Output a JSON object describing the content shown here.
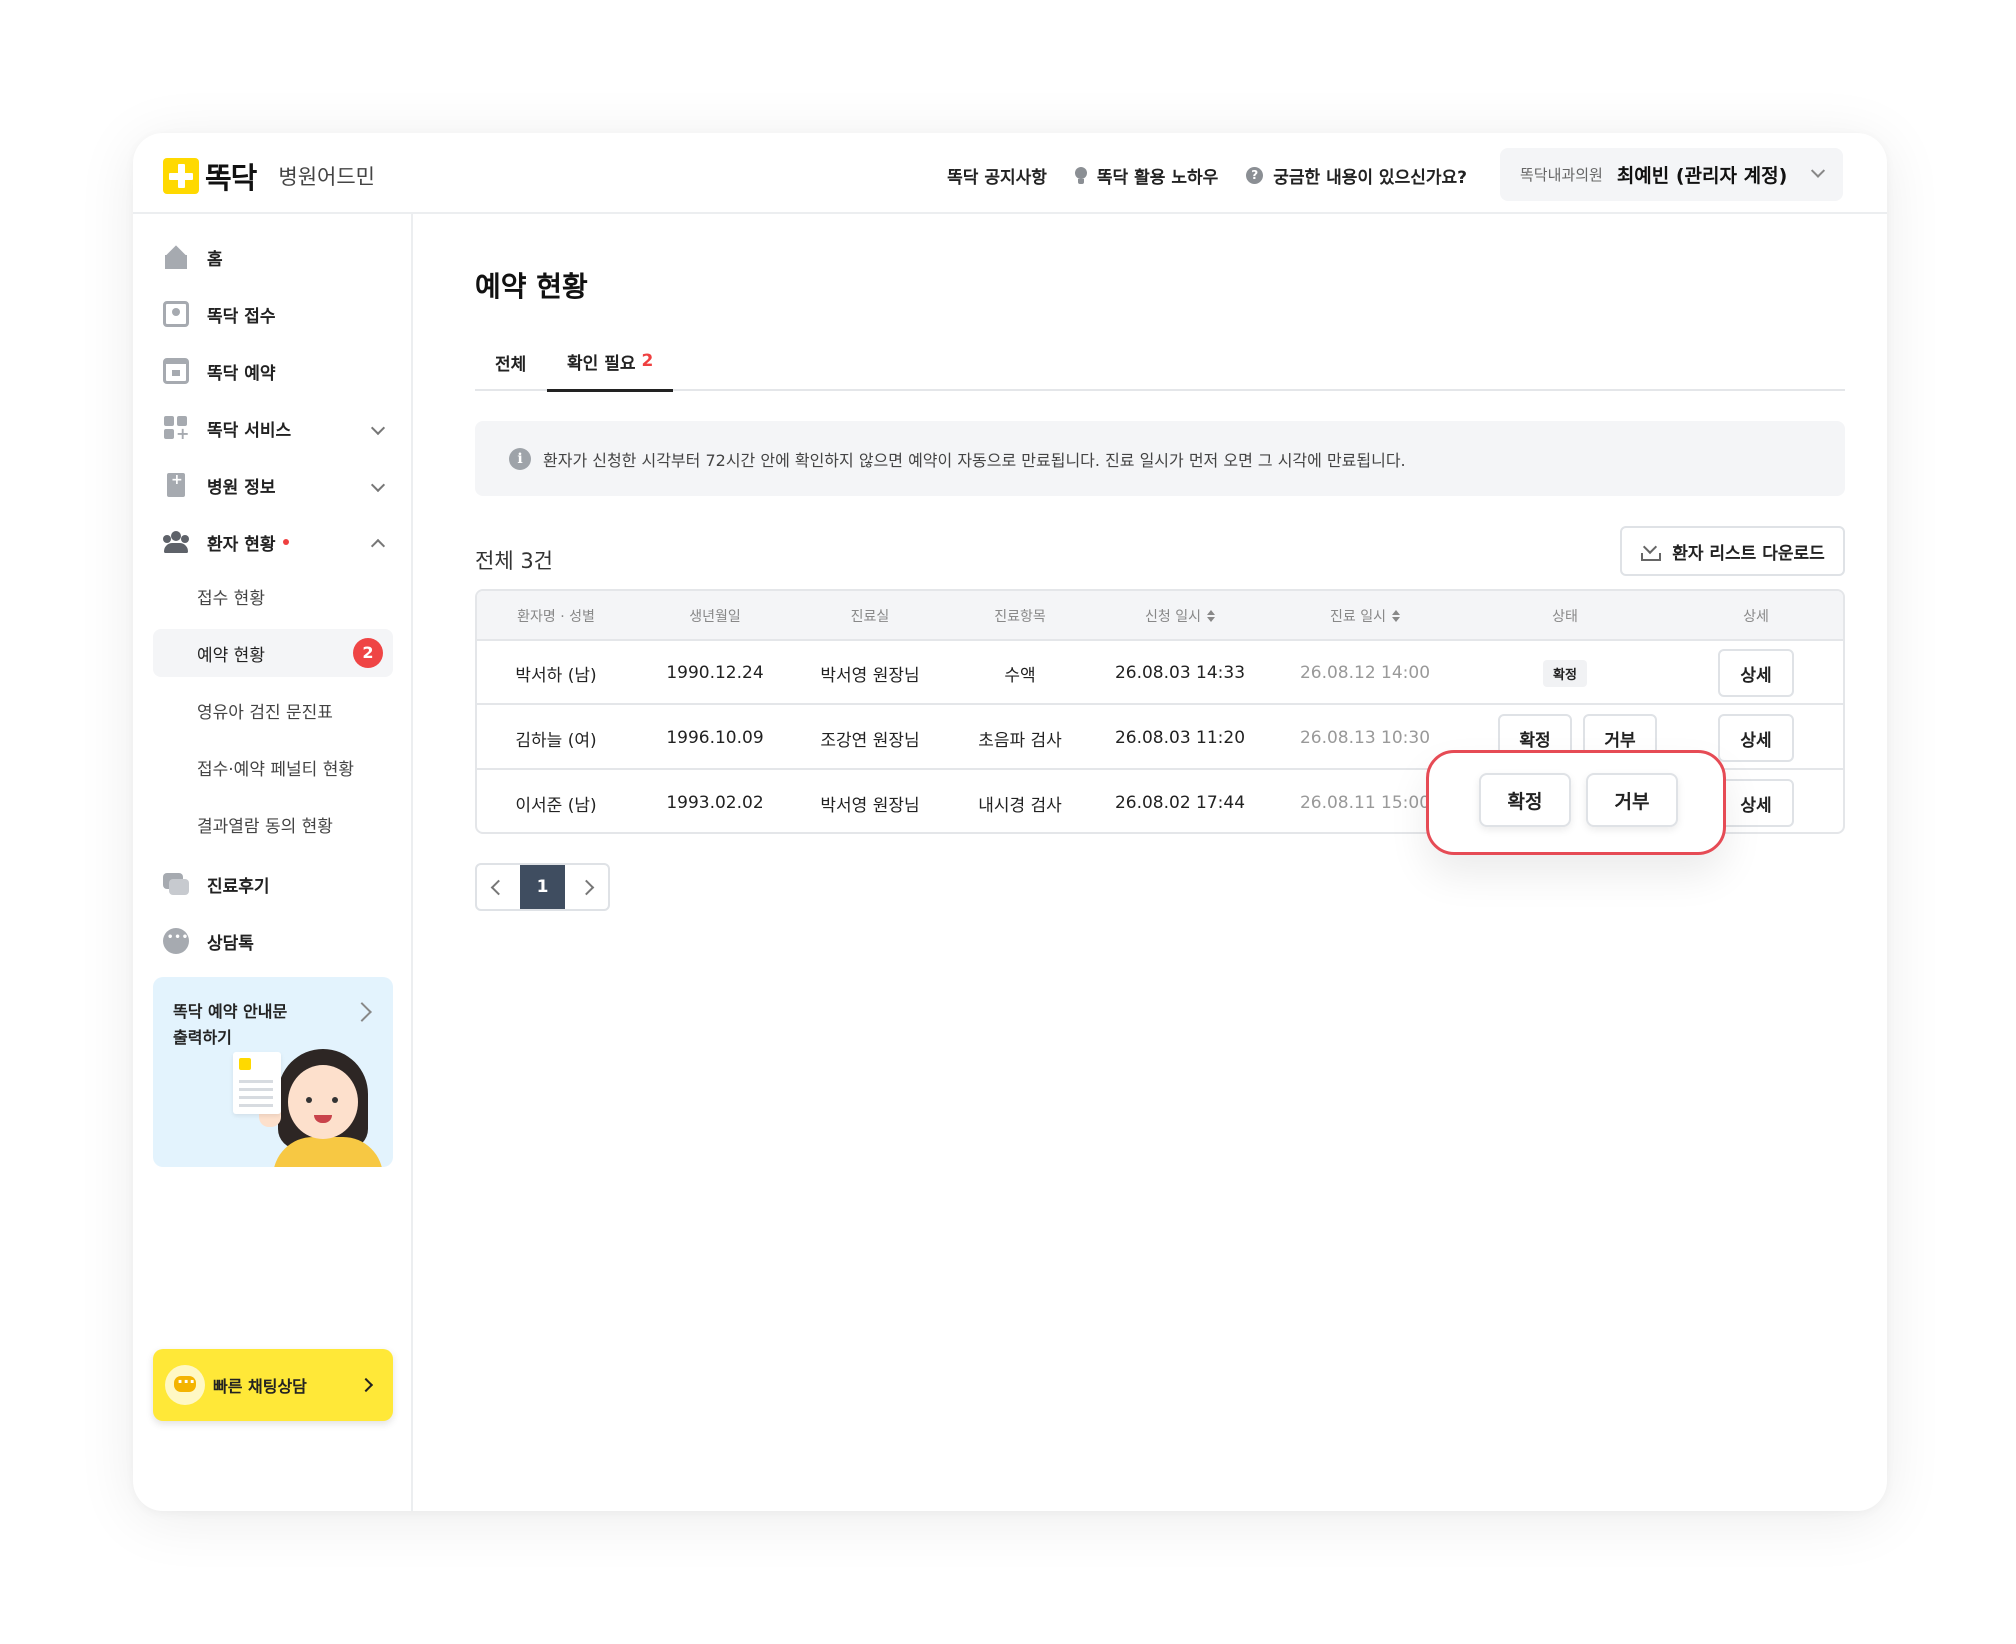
{
  "header": {
    "brand": "똑닥",
    "app_name": "병원어드민",
    "links": [
      "똑닥 공지사항",
      "똑닥 활용 노하우",
      "궁금한 내용이 있으신가요?"
    ],
    "account_hospital": "똑닥내과의원",
    "account_user": "최예빈 (관리자 계정)"
  },
  "sidebar": {
    "items": [
      {
        "label": "홈",
        "icon": "home-icon"
      },
      {
        "label": "똑닥 접수",
        "icon": "reception-icon"
      },
      {
        "label": "똑닥 예약",
        "icon": "calendar-icon"
      },
      {
        "label": "똑닥 서비스",
        "icon": "grid-plus-icon"
      },
      {
        "label": "병원 정보",
        "icon": "hospital-icon"
      },
      {
        "label": "환자 현황",
        "icon": "people-icon"
      },
      {
        "label": "진료후기",
        "icon": "review-icon"
      },
      {
        "label": "상담톡",
        "icon": "chat-icon"
      }
    ],
    "sub_items": [
      {
        "label": "접수 현황"
      },
      {
        "label": "예약 현황",
        "count": "2"
      },
      {
        "label": "영유아 검진 문진표"
      },
      {
        "label": "접수·예약 페널티 현황"
      },
      {
        "label": "결과열람 동의 현황"
      }
    ],
    "promo_text_line1": "똑닥 예약 안내문",
    "promo_text_line2": "출력하기",
    "quick_chat": "빠른 채팅상담"
  },
  "main": {
    "title": "예약 현황",
    "tabs": [
      {
        "label": "전체"
      },
      {
        "label": "확인 필요",
        "count": "2"
      }
    ],
    "notice": "환자가 신청한 시각부터 72시간 안에 확인하지 않으면 예약이 자동으로 만료됩니다. 진료 일시가 먼저 오면 그 시각에 만료됩니다.",
    "total": "전체 3건",
    "download_label": "환자 리스트 다운로드",
    "columns": [
      "환자명 · 성별",
      "생년월일",
      "진료실",
      "진료항목",
      "신청 일시",
      "진료 일시",
      "상태",
      "상세"
    ],
    "rows": [
      {
        "name": "박서하 (남)",
        "birth": "1990.12.24",
        "room": "박서영 원장님",
        "item": "수액",
        "applied": "26.08.03 14:33",
        "visit": "26.08.12 14:00",
        "status": "확정",
        "detail": "상세"
      },
      {
        "name": "김하늘 (여)",
        "birth": "1996.10.09",
        "room": "조강연 원장님",
        "item": "초음파 검사",
        "applied": "26.08.03 11:20",
        "visit": "26.08.13 10:30",
        "confirm": "확정",
        "reject": "거부",
        "detail": "상세"
      },
      {
        "name": "이서준 (남)",
        "birth": "1993.02.02",
        "room": "박서영 원장님",
        "item": "내시경 검사",
        "applied": "26.08.02 17:44",
        "visit": "26.08.11 15:00",
        "confirm": "확정",
        "reject": "거부",
        "detail": "상세"
      }
    ],
    "pagination": {
      "current": "1"
    }
  },
  "colors": {
    "brand_yellow": "#ffd900",
    "alert_red": "#ef4040",
    "highlight_border": "#e64b55",
    "page_active": "#3f4d60"
  }
}
